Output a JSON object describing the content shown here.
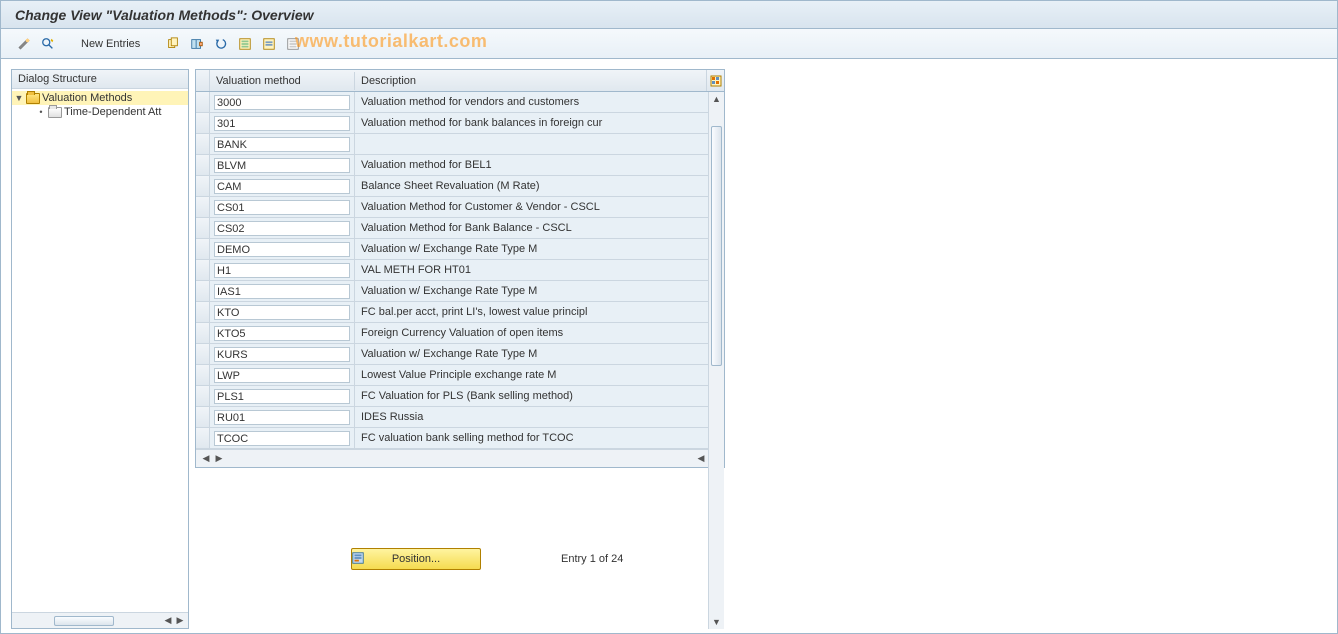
{
  "header": {
    "title": "Change View \"Valuation Methods\": Overview"
  },
  "toolbar": {
    "new_entries_label": "New Entries"
  },
  "watermark": "www.tutorialkart.com",
  "tree": {
    "header": "Dialog Structure",
    "items": [
      {
        "label": "Valuation Methods",
        "selected": true,
        "open": true
      },
      {
        "label": "Time-Dependent Att",
        "selected": false,
        "open": false,
        "child": true
      }
    ]
  },
  "table": {
    "columns": {
      "method": "Valuation method",
      "description": "Description"
    },
    "rows": [
      {
        "method": "3000",
        "description": "Valuation method for vendors and customers"
      },
      {
        "method": "301",
        "description": "Valuation method for bank balances in foreign cur"
      },
      {
        "method": "BANK",
        "description": ""
      },
      {
        "method": "BLVM",
        "description": "Valuation method for BEL1"
      },
      {
        "method": "CAM",
        "description": "Balance Sheet Revaluation (M Rate)"
      },
      {
        "method": "CS01",
        "description": "Valuation Method for Customer & Vendor - CSCL"
      },
      {
        "method": "CS02",
        "description": "Valuation Method for Bank Balance - CSCL"
      },
      {
        "method": "DEMO",
        "description": "Valuation w/ Exchange Rate Type M"
      },
      {
        "method": "H1",
        "description": "VAL METH FOR HT01"
      },
      {
        "method": "IAS1",
        "description": "Valuation w/ Exchange Rate Type M"
      },
      {
        "method": "KTO",
        "description": "FC bal.per acct, print LI's, lowest value principl"
      },
      {
        "method": "KTO5",
        "description": "Foreign Currency Valuation of open items"
      },
      {
        "method": "KURS",
        "description": "Valuation w/ Exchange Rate Type M"
      },
      {
        "method": "LWP",
        "description": "Lowest Value Principle exchange rate M"
      },
      {
        "method": "PLS1",
        "description": "FC Valuation for PLS (Bank selling method)"
      },
      {
        "method": "RU01",
        "description": "IDES Russia"
      },
      {
        "method": "TCOC",
        "description": "FC valuation bank selling method for TCOC"
      }
    ]
  },
  "footer": {
    "position_button": "Position...",
    "entry_text": "Entry 1 of 24"
  }
}
